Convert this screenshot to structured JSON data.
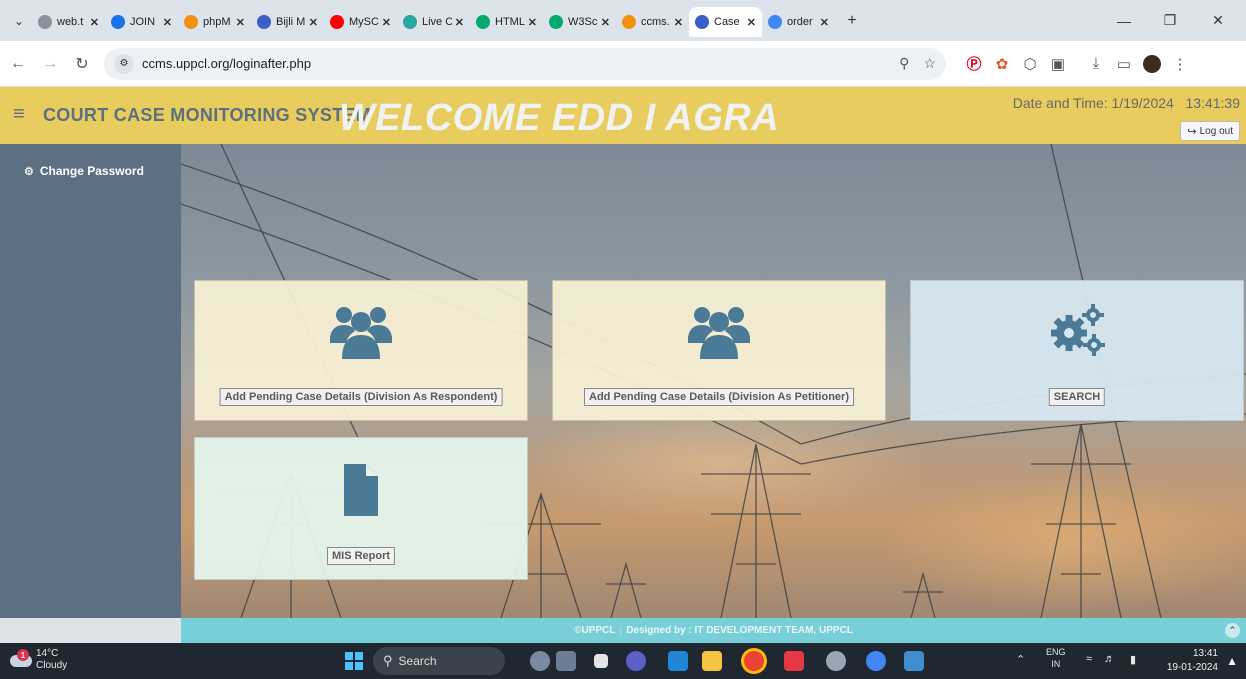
{
  "browser": {
    "tabs": [
      {
        "title": "web.t",
        "icon": "globe-icon",
        "color": "#8a94a0"
      },
      {
        "title": "JOIN",
        "icon": "meet-icon",
        "color": "#1a73e8"
      },
      {
        "title": "phpM",
        "icon": "phpmyadmin-icon",
        "color": "#f29111"
      },
      {
        "title": "Bijli M",
        "icon": "site-icon",
        "color": "#3a5fc8"
      },
      {
        "title": "MySC",
        "icon": "youtube-icon",
        "color": "#ff0000"
      },
      {
        "title": "Live C",
        "icon": "live-icon",
        "color": "#2aa6a0"
      },
      {
        "title": "HTML",
        "icon": "w3schools-icon",
        "color": "#04aa6d"
      },
      {
        "title": "W3Sc",
        "icon": "w3schools-icon",
        "color": "#04aa6d"
      },
      {
        "title": "ccms.",
        "icon": "phpmyadmin-icon",
        "color": "#f29111"
      },
      {
        "title": "Case",
        "icon": "site-icon",
        "color": "#3a5fc8",
        "active": true
      },
      {
        "title": "order",
        "icon": "google-icon",
        "color": "#4285f4"
      }
    ],
    "url": "ccms.uppcl.org/loginafter.php"
  },
  "app": {
    "brand": "COURT CASE MONITORING SYSTEM",
    "datetime": "Date and Time: 1/19/2024   13:41:39",
    "logout_label": "Log out",
    "sidebar": {
      "change_password": "Change Password"
    },
    "welcome": "WELCOME EDD I AGRA",
    "cards": {
      "respondent": "Add Pending Case Details (Division As Respondent)",
      "petitioner": "Add Pending Case Details (Division As Petitioner)",
      "search": "SEARCH",
      "mis": "MIS Report"
    },
    "footer": {
      "copyright": "©UPPCL",
      "separator": "|",
      "designed": "Designed by : IT DEVELOPMENT TEAM, UPPCL"
    }
  },
  "taskbar": {
    "weather_temp": "14°C",
    "weather_desc": "Cloudy",
    "weather_badge": "1",
    "search_label": "Search",
    "lang_top": "ENG",
    "lang_bottom": "IN",
    "time": "13:41",
    "date": "19-01-2024"
  },
  "colors": {
    "header": "#e8cc5e",
    "sidebar": "#5d6f82",
    "footer": "#78cfd8",
    "card_icon": "#4a7a96"
  }
}
